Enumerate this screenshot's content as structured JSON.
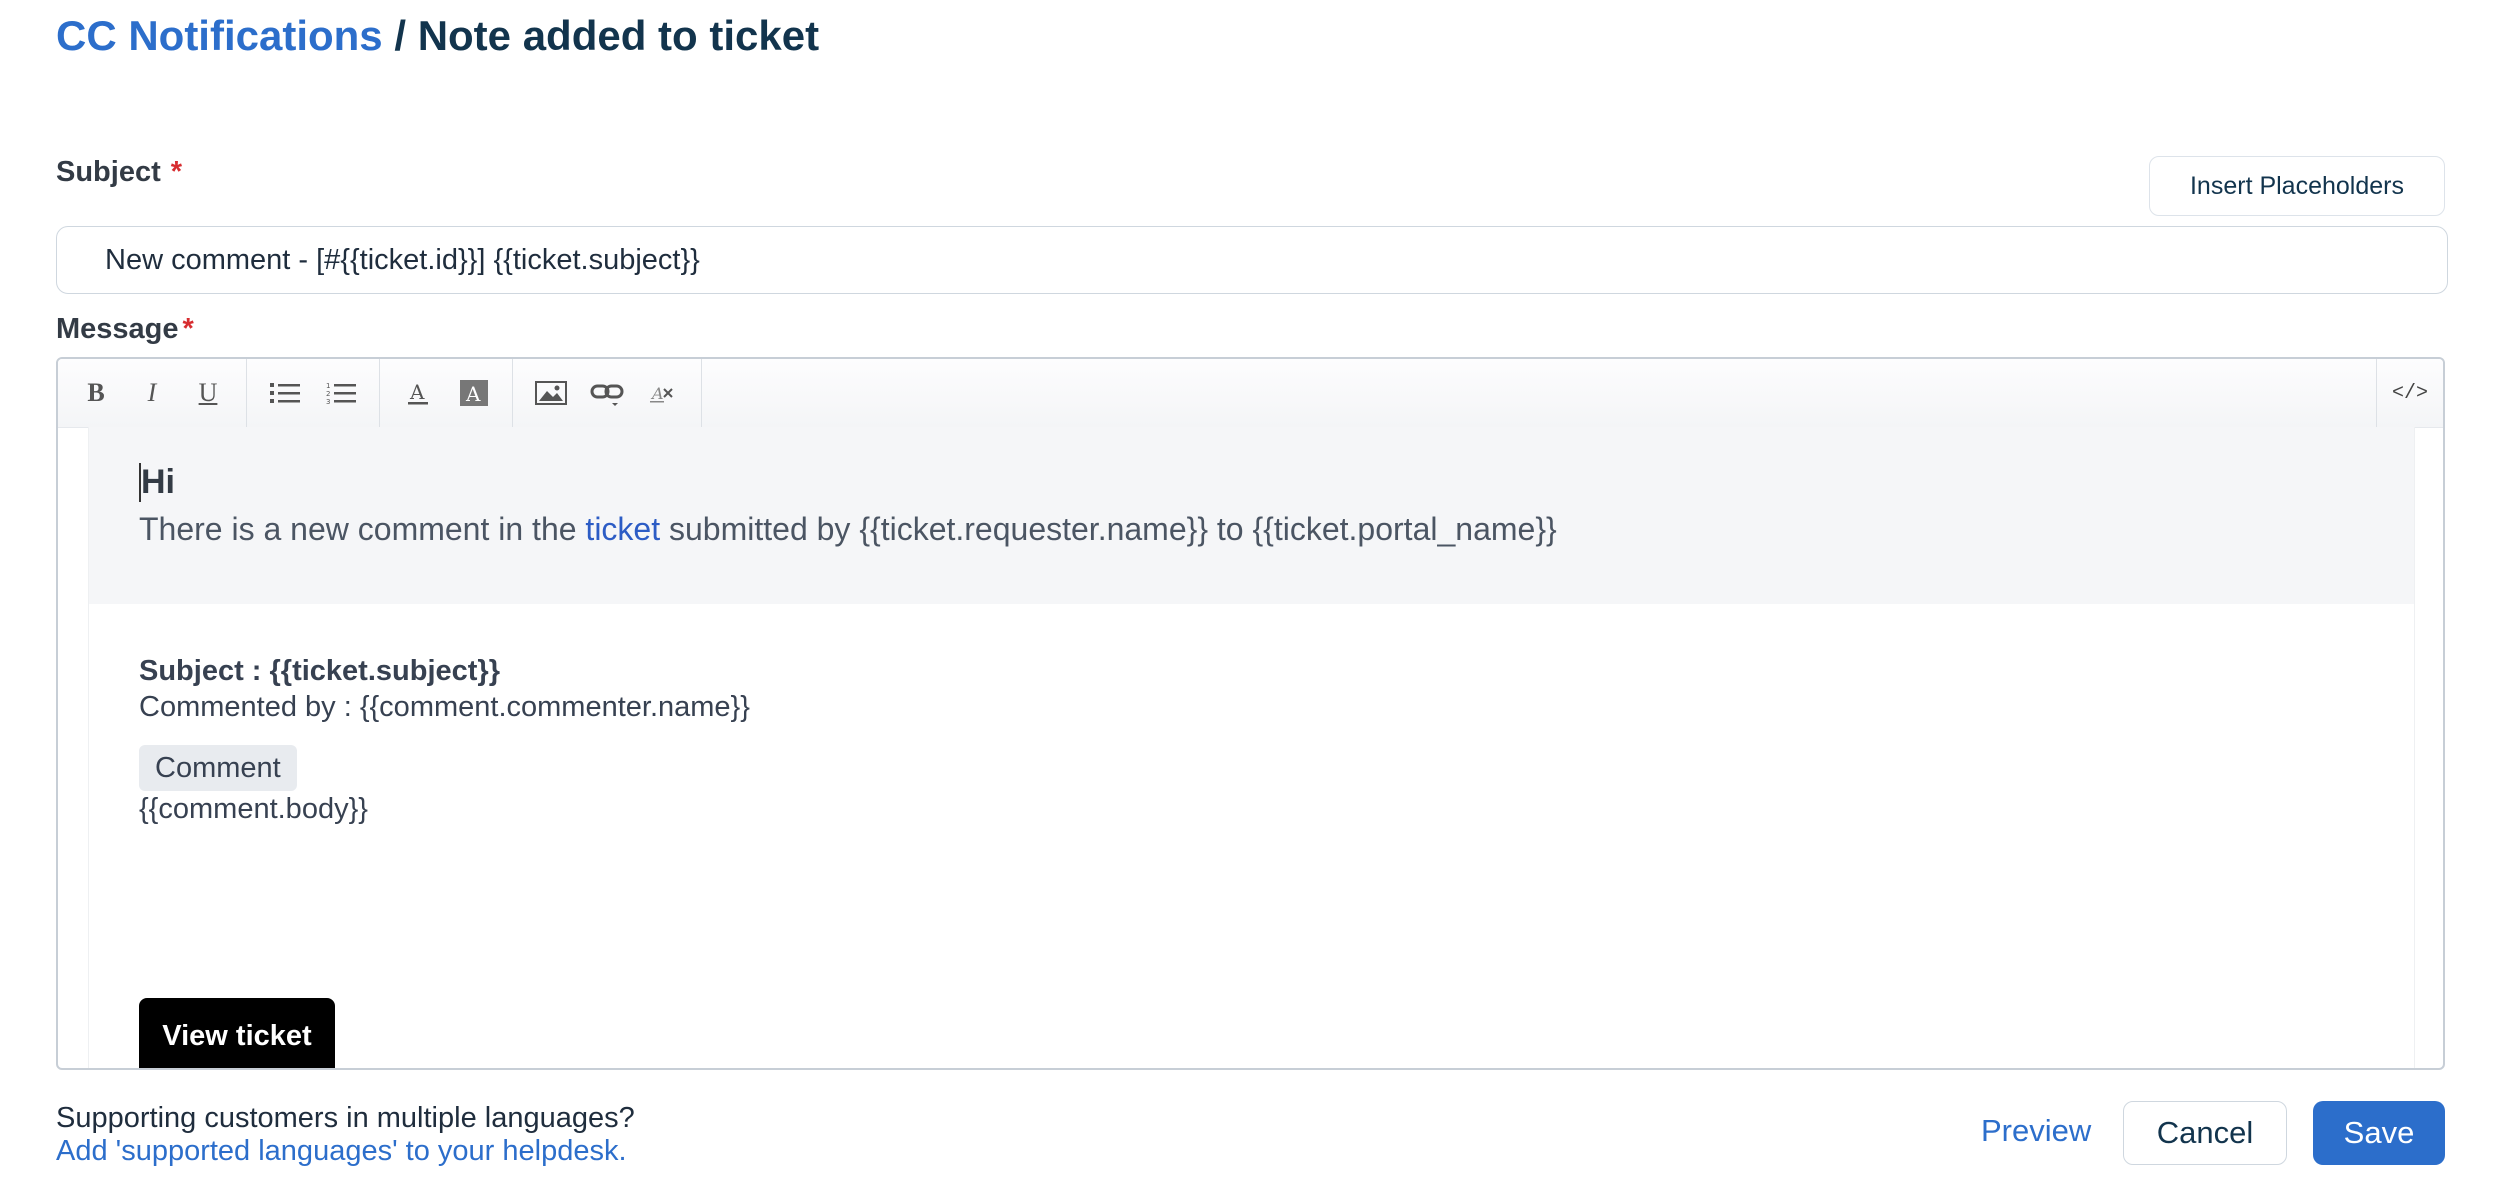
{
  "breadcrumb": {
    "parent": "CC Notifications",
    "separator": " / ",
    "current": "Note added to ticket"
  },
  "subject": {
    "label": "Subject",
    "required_marker": "*",
    "value": "New comment - [#{{ticket.id}}] {{ticket.subject}}",
    "insert_placeholders_label": "Insert Placeholders"
  },
  "message": {
    "label": "Message",
    "required_marker": "*",
    "toolbar": {
      "bold": "B",
      "italic": "I",
      "underline": "U",
      "icons": [
        "bold-icon",
        "italic-icon",
        "underline-icon",
        "bullet-list-icon",
        "numbered-list-icon",
        "font-color-icon",
        "background-color-icon",
        "image-icon",
        "link-icon",
        "clear-format-icon",
        "code-view-icon"
      ],
      "code_view": "</>"
    },
    "content": {
      "greeting": "Hi",
      "intro_before": "There is a new comment in the ",
      "intro_link": "ticket",
      "intro_after": " submitted by {{ticket.requester.name}} to {{ticket.portal_name}}",
      "subject_line": "Subject : {{ticket.subject}}",
      "commented_by": "Commented by : {{comment.commenter.name}}",
      "comment_tag": "Comment",
      "comment_body": "{{comment.body}}",
      "view_ticket": "View ticket"
    }
  },
  "footer": {
    "support_question": "Supporting customers in multiple languages?",
    "support_link": "Add 'supported languages' to your helpdesk.",
    "preview": "Preview",
    "cancel": "Cancel",
    "save": "Save"
  },
  "colors": {
    "accent": "#2c6ecb",
    "required": "#d72d30",
    "heading": "#12344d"
  }
}
